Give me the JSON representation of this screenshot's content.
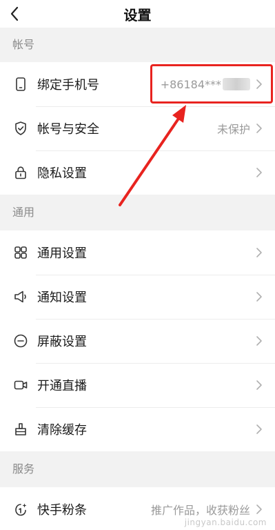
{
  "header": {
    "title": "设置"
  },
  "sections": [
    {
      "label": "帐号"
    },
    {
      "label": "通用"
    },
    {
      "label": "服务"
    }
  ],
  "account": {
    "phone": {
      "label": "绑定手机号",
      "value": "+86184***"
    },
    "security": {
      "label": "帐号与安全",
      "value": "未保护"
    },
    "privacy": {
      "label": "隐私设置"
    }
  },
  "general": {
    "general_settings": {
      "label": "通用设置"
    },
    "notifications": {
      "label": "通知设置"
    },
    "block": {
      "label": "屏蔽设置"
    },
    "live": {
      "label": "开通直播"
    },
    "cache": {
      "label": "清除缓存"
    }
  },
  "service": {
    "fans": {
      "label": "快手粉条",
      "value": "推广作品，收获粉丝"
    }
  },
  "watermark": "jingyan.baidu.com",
  "colors": {
    "highlight": "#e8231f",
    "text_secondary": "#9a9a9a"
  }
}
